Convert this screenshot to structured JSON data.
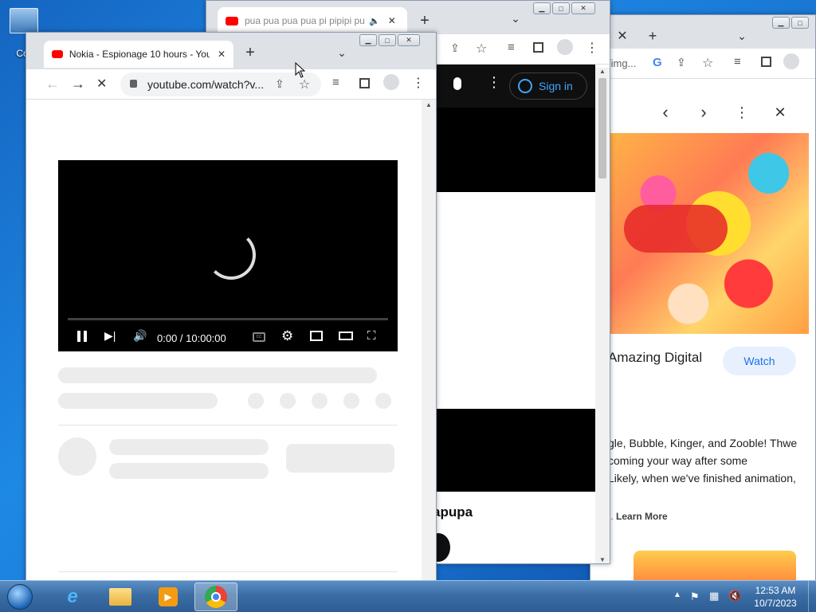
{
  "desktop": {
    "icon_label": "Cor"
  },
  "window_back": {
    "tab_title": "pua pua pua pua pi pipipi pu",
    "new_tab": "+",
    "chevron": "⌄"
  },
  "window_mid": {
    "sign_in": "Sign in",
    "video_title_partial": "apupa"
  },
  "window_right": {
    "address_partial": "/img...",
    "card_title_partial": "Amazing Digital",
    "watch_label": "Watch",
    "description_lines": [
      "gle, Bubble, Kinger, and Zooble! Thwe",
      "coming your way after some",
      "Likely, when we've finished animation,"
    ],
    "learn_prefix": "t.",
    "learn_more": "Learn More"
  },
  "window_front": {
    "tab_title": "Nokia - Espionage 10 hours - You",
    "new_tab": "+",
    "url": "youtube.com/watch?v...",
    "player": {
      "time": "0:00 / 10:00:00",
      "progress": 0.0
    }
  },
  "taskbar": {
    "time": "12:53 AM",
    "date": "10/7/2023"
  },
  "colors": {
    "youtube_red": "#ff0000",
    "sign_in_blue": "#3ea6ff",
    "watch_bg": "#e8f0fe",
    "watch_text": "#1a73e8"
  }
}
